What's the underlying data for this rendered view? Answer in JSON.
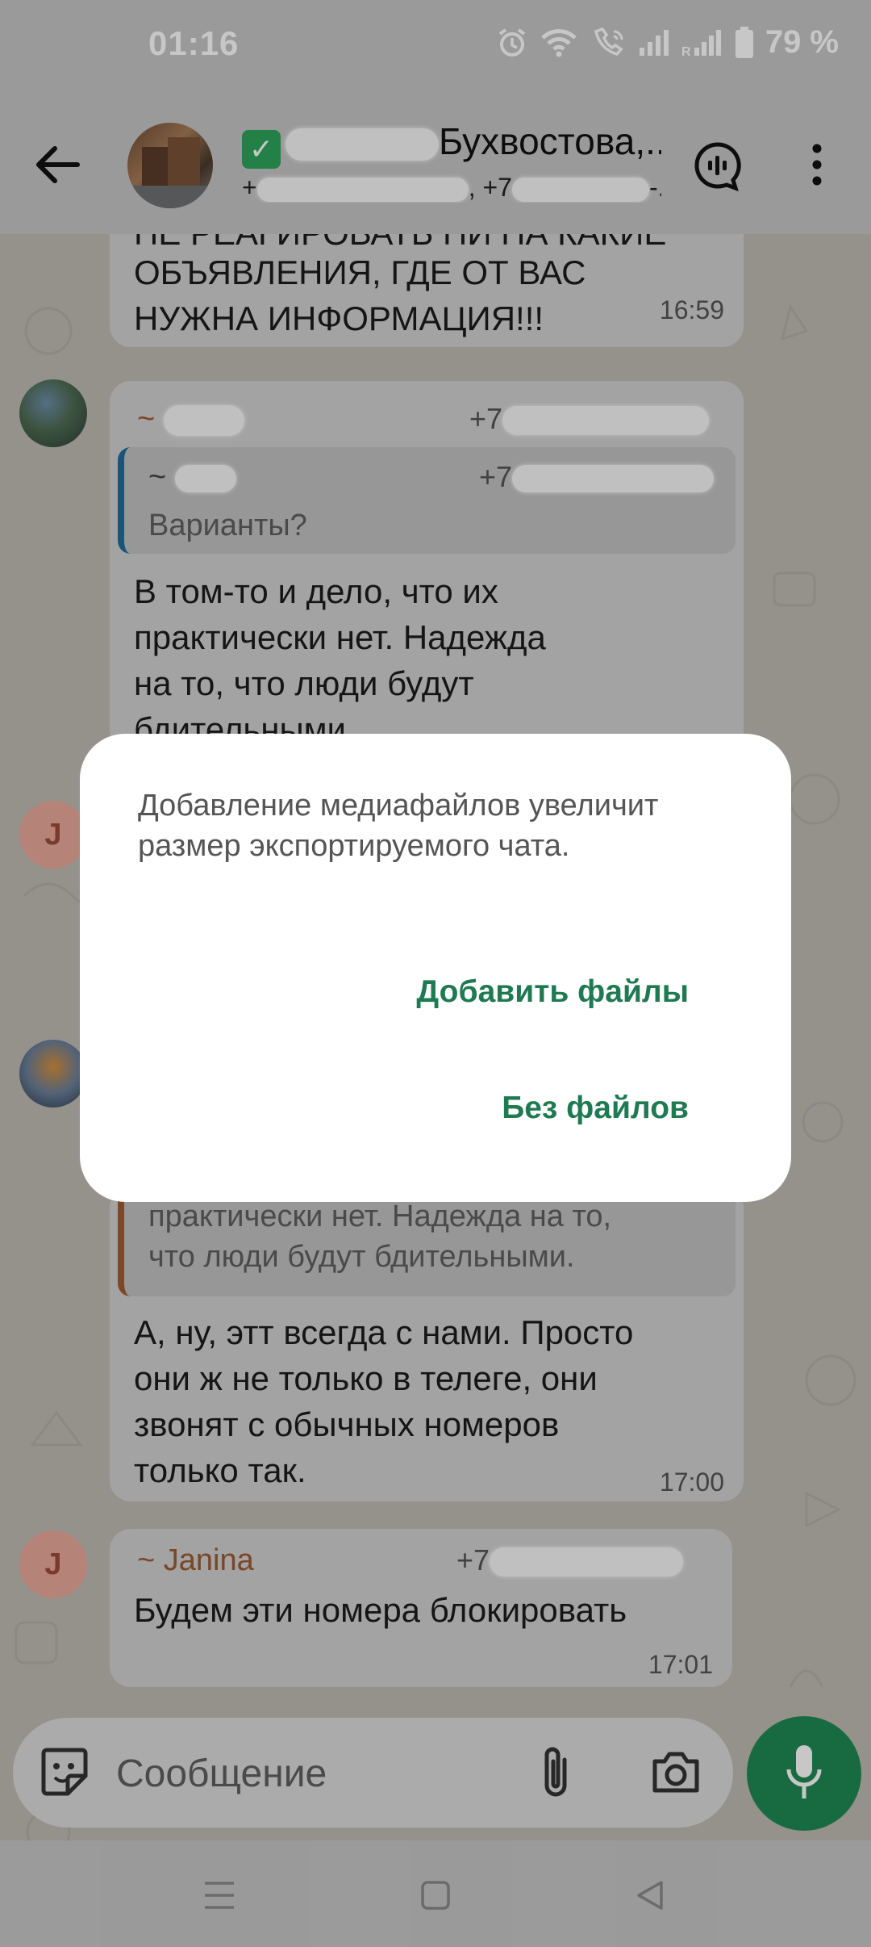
{
  "status_bar": {
    "time": "01:16",
    "battery": "79 %"
  },
  "header": {
    "title_visible": "Бухвостова,...",
    "subtitle_visible_start": "+",
    "subtitle_visible_mid": ", +7",
    "subtitle_visible_end": "-..."
  },
  "messages": [
    {
      "id": "m1",
      "text_clipped": "НЕ РЕАГИРОВАТЬ НИ НА КАКИЕ",
      "text": "ОБЪЯВЛЕНИЯ, ГДЕ ОТ ВАС\nНУЖНА ИНФОРМАЦИЯ!!!",
      "time": "16:59"
    },
    {
      "id": "m2",
      "sender_prefix": "~",
      "phone_prefix": "+7",
      "quote": {
        "sender_prefix": "~",
        "phone_prefix": "+7",
        "text": "Варианты?"
      },
      "text": "В том-то и дело, что их\nпрактически нет. Надежда\nна то, что люди будут\nбдительными"
    },
    {
      "id": "m3",
      "quote_text": "практически нет. Надежда на то,\nчто люди будут бдительными.",
      "text": "А, ну, этт всегда с нами. Просто\nони ж не только в телеге, они\nзвонят с обычных номеров\nтолько так.",
      "time": "17:00"
    },
    {
      "id": "m4",
      "sender": "~ Janina",
      "phone_prefix": "+7",
      "text": "Будем эти номера блокировать",
      "time": "17:01"
    }
  ],
  "avatars": {
    "j_letter": "J"
  },
  "dialog": {
    "message": "Добавление медиафайлов увеличит размер экспортируемого чата.",
    "add_files": "Добавить файлы",
    "no_files": "Без файлов"
  },
  "composer": {
    "placeholder": "Сообщение"
  },
  "colors": {
    "accent": "#1f7a52",
    "mic": "#1f8a54",
    "sender": "#9c5a34",
    "quote_blue": "#1f6e9c",
    "quote_orange": "#a35b32"
  }
}
